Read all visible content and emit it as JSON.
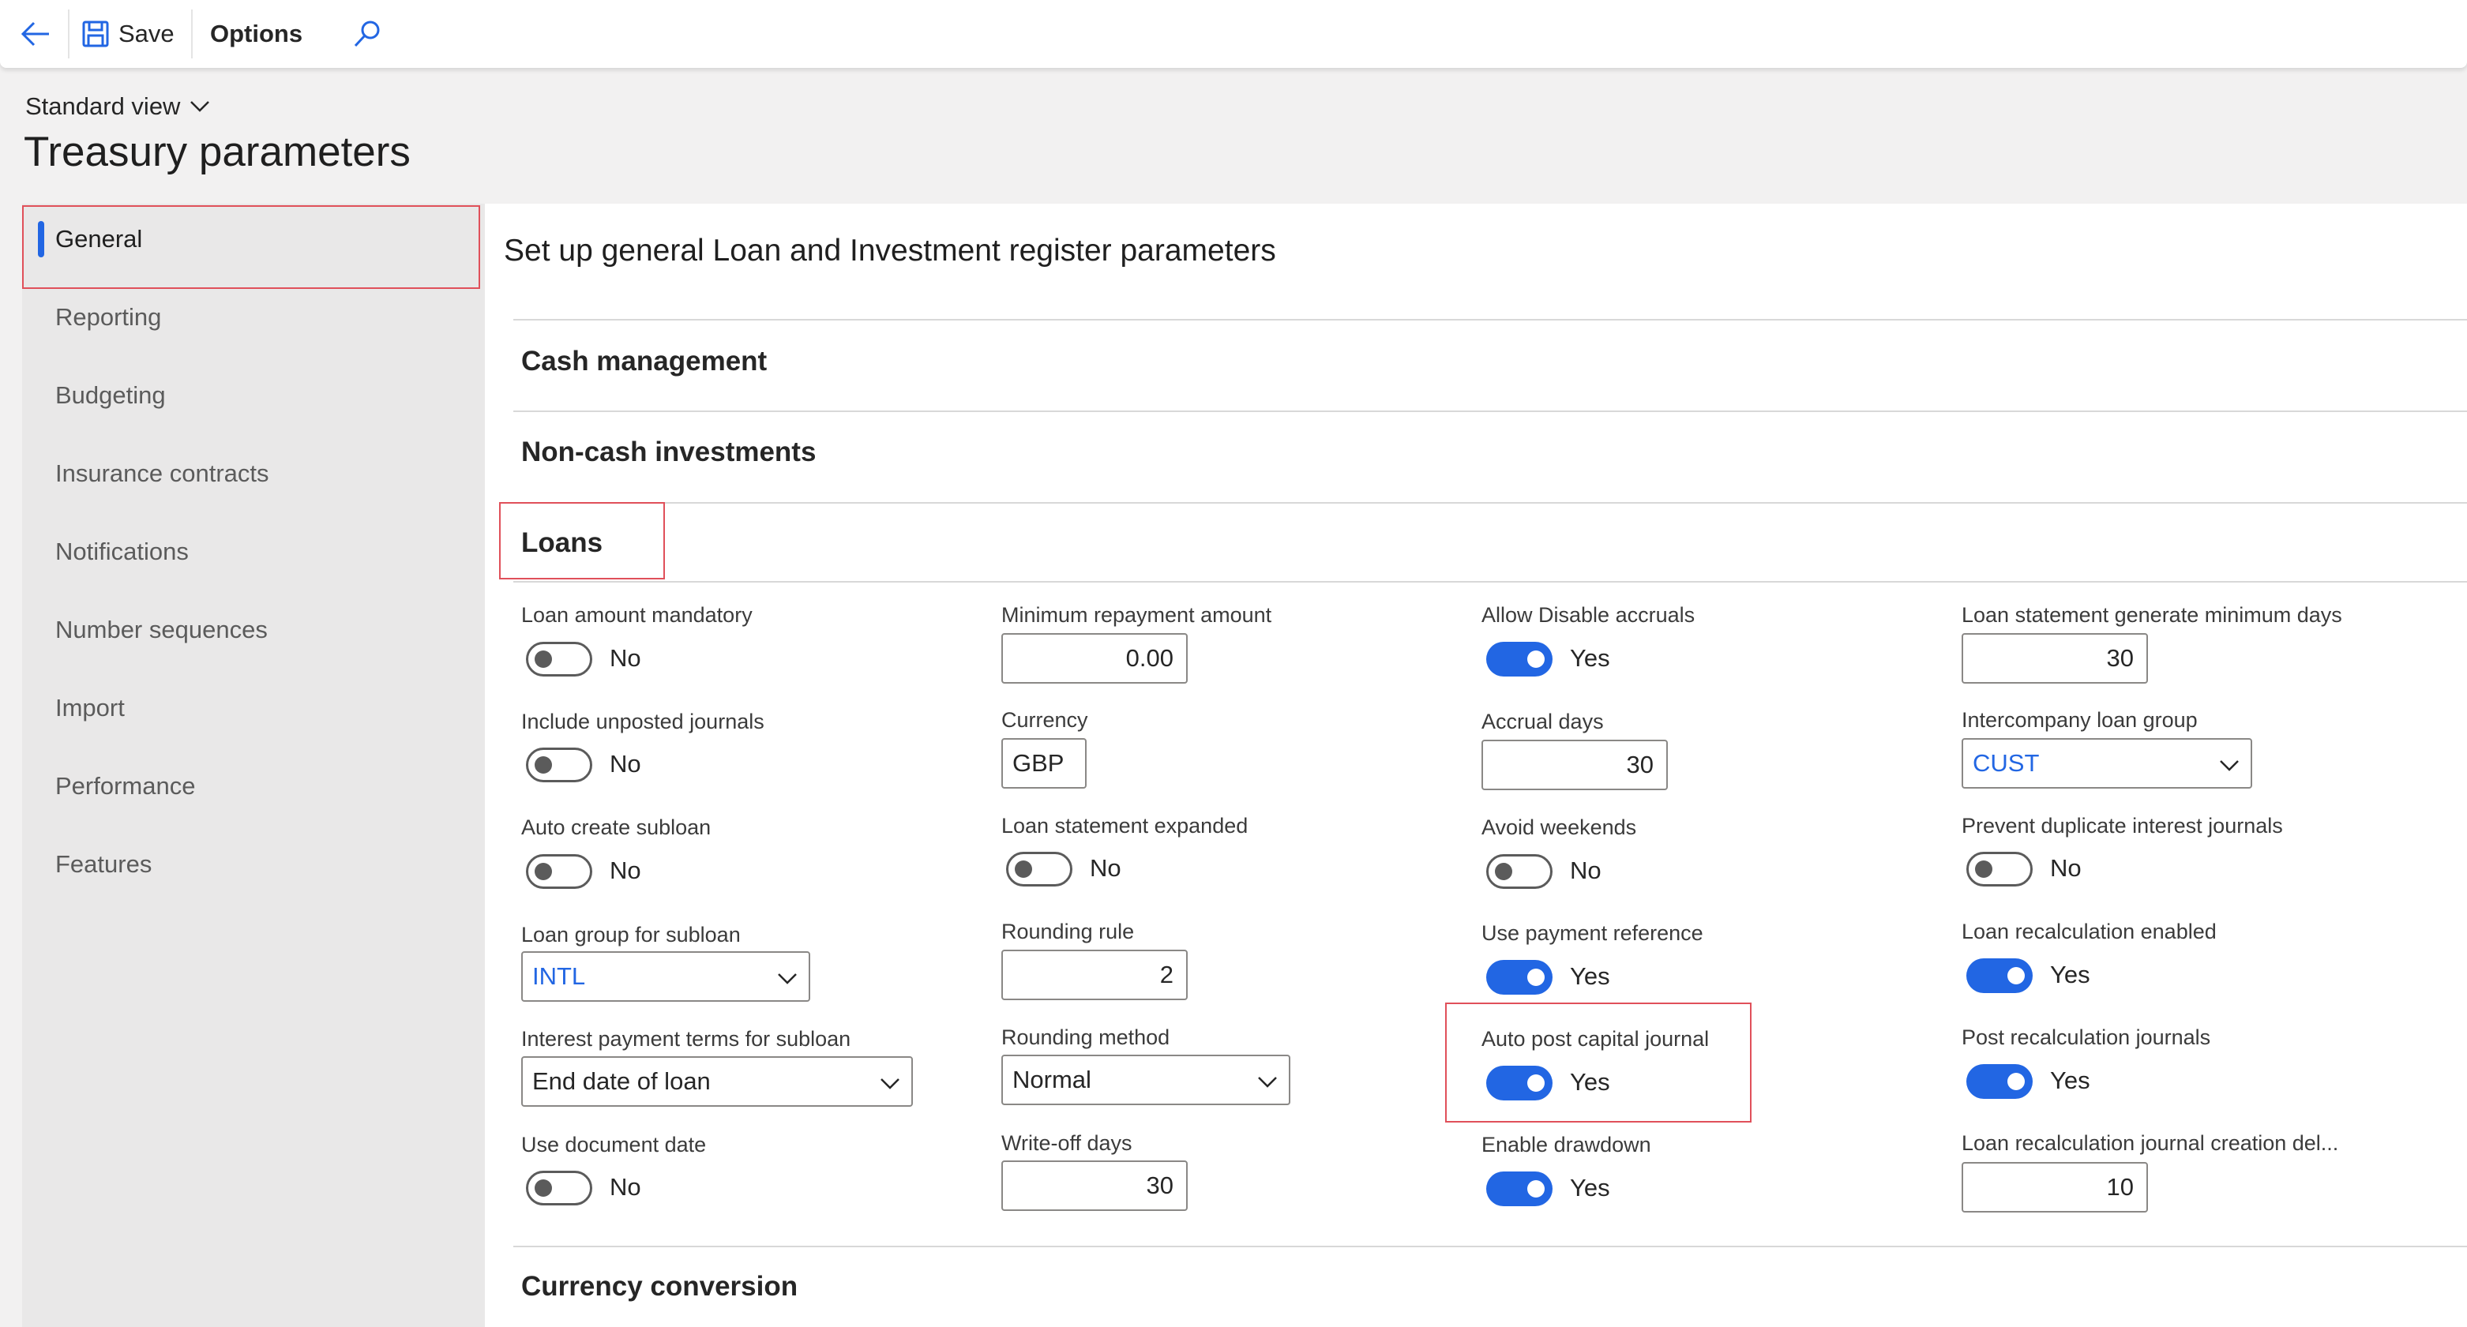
{
  "toolbar": {
    "save_label": "Save",
    "options_label": "Options",
    "back_icon": "back-arrow-icon",
    "save_icon": "save-icon",
    "search_icon": "search-icon"
  },
  "view": {
    "label": "Standard view"
  },
  "page": {
    "title": "Treasury parameters"
  },
  "nav": {
    "items": [
      {
        "label": "General",
        "active": true
      },
      {
        "label": "Reporting"
      },
      {
        "label": "Budgeting"
      },
      {
        "label": "Insurance contracts"
      },
      {
        "label": "Notifications"
      },
      {
        "label": "Number sequences"
      },
      {
        "label": "Import"
      },
      {
        "label": "Performance"
      },
      {
        "label": "Features"
      }
    ]
  },
  "main": {
    "title": "Set up general Loan and Investment register parameters",
    "sections": {
      "cash": "Cash management",
      "noncash": "Non-cash investments",
      "loans": "Loans",
      "currency": "Currency conversion"
    }
  },
  "loans": {
    "loan_amount_mandatory": {
      "label": "Loan amount mandatory",
      "value": "No"
    },
    "include_unposted_journals": {
      "label": "Include unposted journals",
      "value": "No"
    },
    "auto_create_subloan": {
      "label": "Auto create subloan",
      "value": "No"
    },
    "loan_group_for_subloan": {
      "label": "Loan group for subloan",
      "value": "INTL"
    },
    "interest_payment_terms": {
      "label": "Interest payment terms for subloan",
      "value": "End date of loan"
    },
    "use_document_date": {
      "label": "Use document date",
      "value": "No"
    },
    "minimum_repayment_amount": {
      "label": "Minimum repayment amount",
      "value": "0.00"
    },
    "currency": {
      "label": "Currency",
      "value": "GBP"
    },
    "loan_statement_expanded": {
      "label": "Loan statement expanded",
      "value": "No"
    },
    "rounding_rule": {
      "label": "Rounding rule",
      "value": "2"
    },
    "rounding_method": {
      "label": "Rounding method",
      "value": "Normal"
    },
    "write_off_days": {
      "label": "Write-off days",
      "value": "30"
    },
    "allow_disable_accruals": {
      "label": "Allow Disable accruals",
      "value": "Yes"
    },
    "accrual_days": {
      "label": "Accrual days",
      "value": "30"
    },
    "avoid_weekends": {
      "label": "Avoid weekends",
      "value": "No"
    },
    "use_payment_reference": {
      "label": "Use payment reference",
      "value": "Yes"
    },
    "auto_post_capital_journal": {
      "label": "Auto post capital journal",
      "value": "Yes"
    },
    "enable_drawdown": {
      "label": "Enable drawdown",
      "value": "Yes"
    },
    "loan_statement_generate_min_days": {
      "label": "Loan statement generate minimum days",
      "value": "30"
    },
    "intercompany_loan_group": {
      "label": "Intercompany loan group",
      "value": "CUST"
    },
    "prevent_duplicate_interest_journals": {
      "label": "Prevent duplicate interest journals",
      "value": "No"
    },
    "loan_recalculation_enabled": {
      "label": "Loan recalculation enabled",
      "value": "Yes"
    },
    "post_recalculation_journals": {
      "label": "Post recalculation journals",
      "value": "Yes"
    },
    "loan_recalc_journal_creation_delay": {
      "label": "Loan recalculation journal creation del...",
      "value": "10"
    }
  },
  "colors": {
    "accent": "#2266e3",
    "highlight_box": "#e0505a",
    "nav_background": "#e9e8e8",
    "page_background": "#f2f1f1"
  }
}
